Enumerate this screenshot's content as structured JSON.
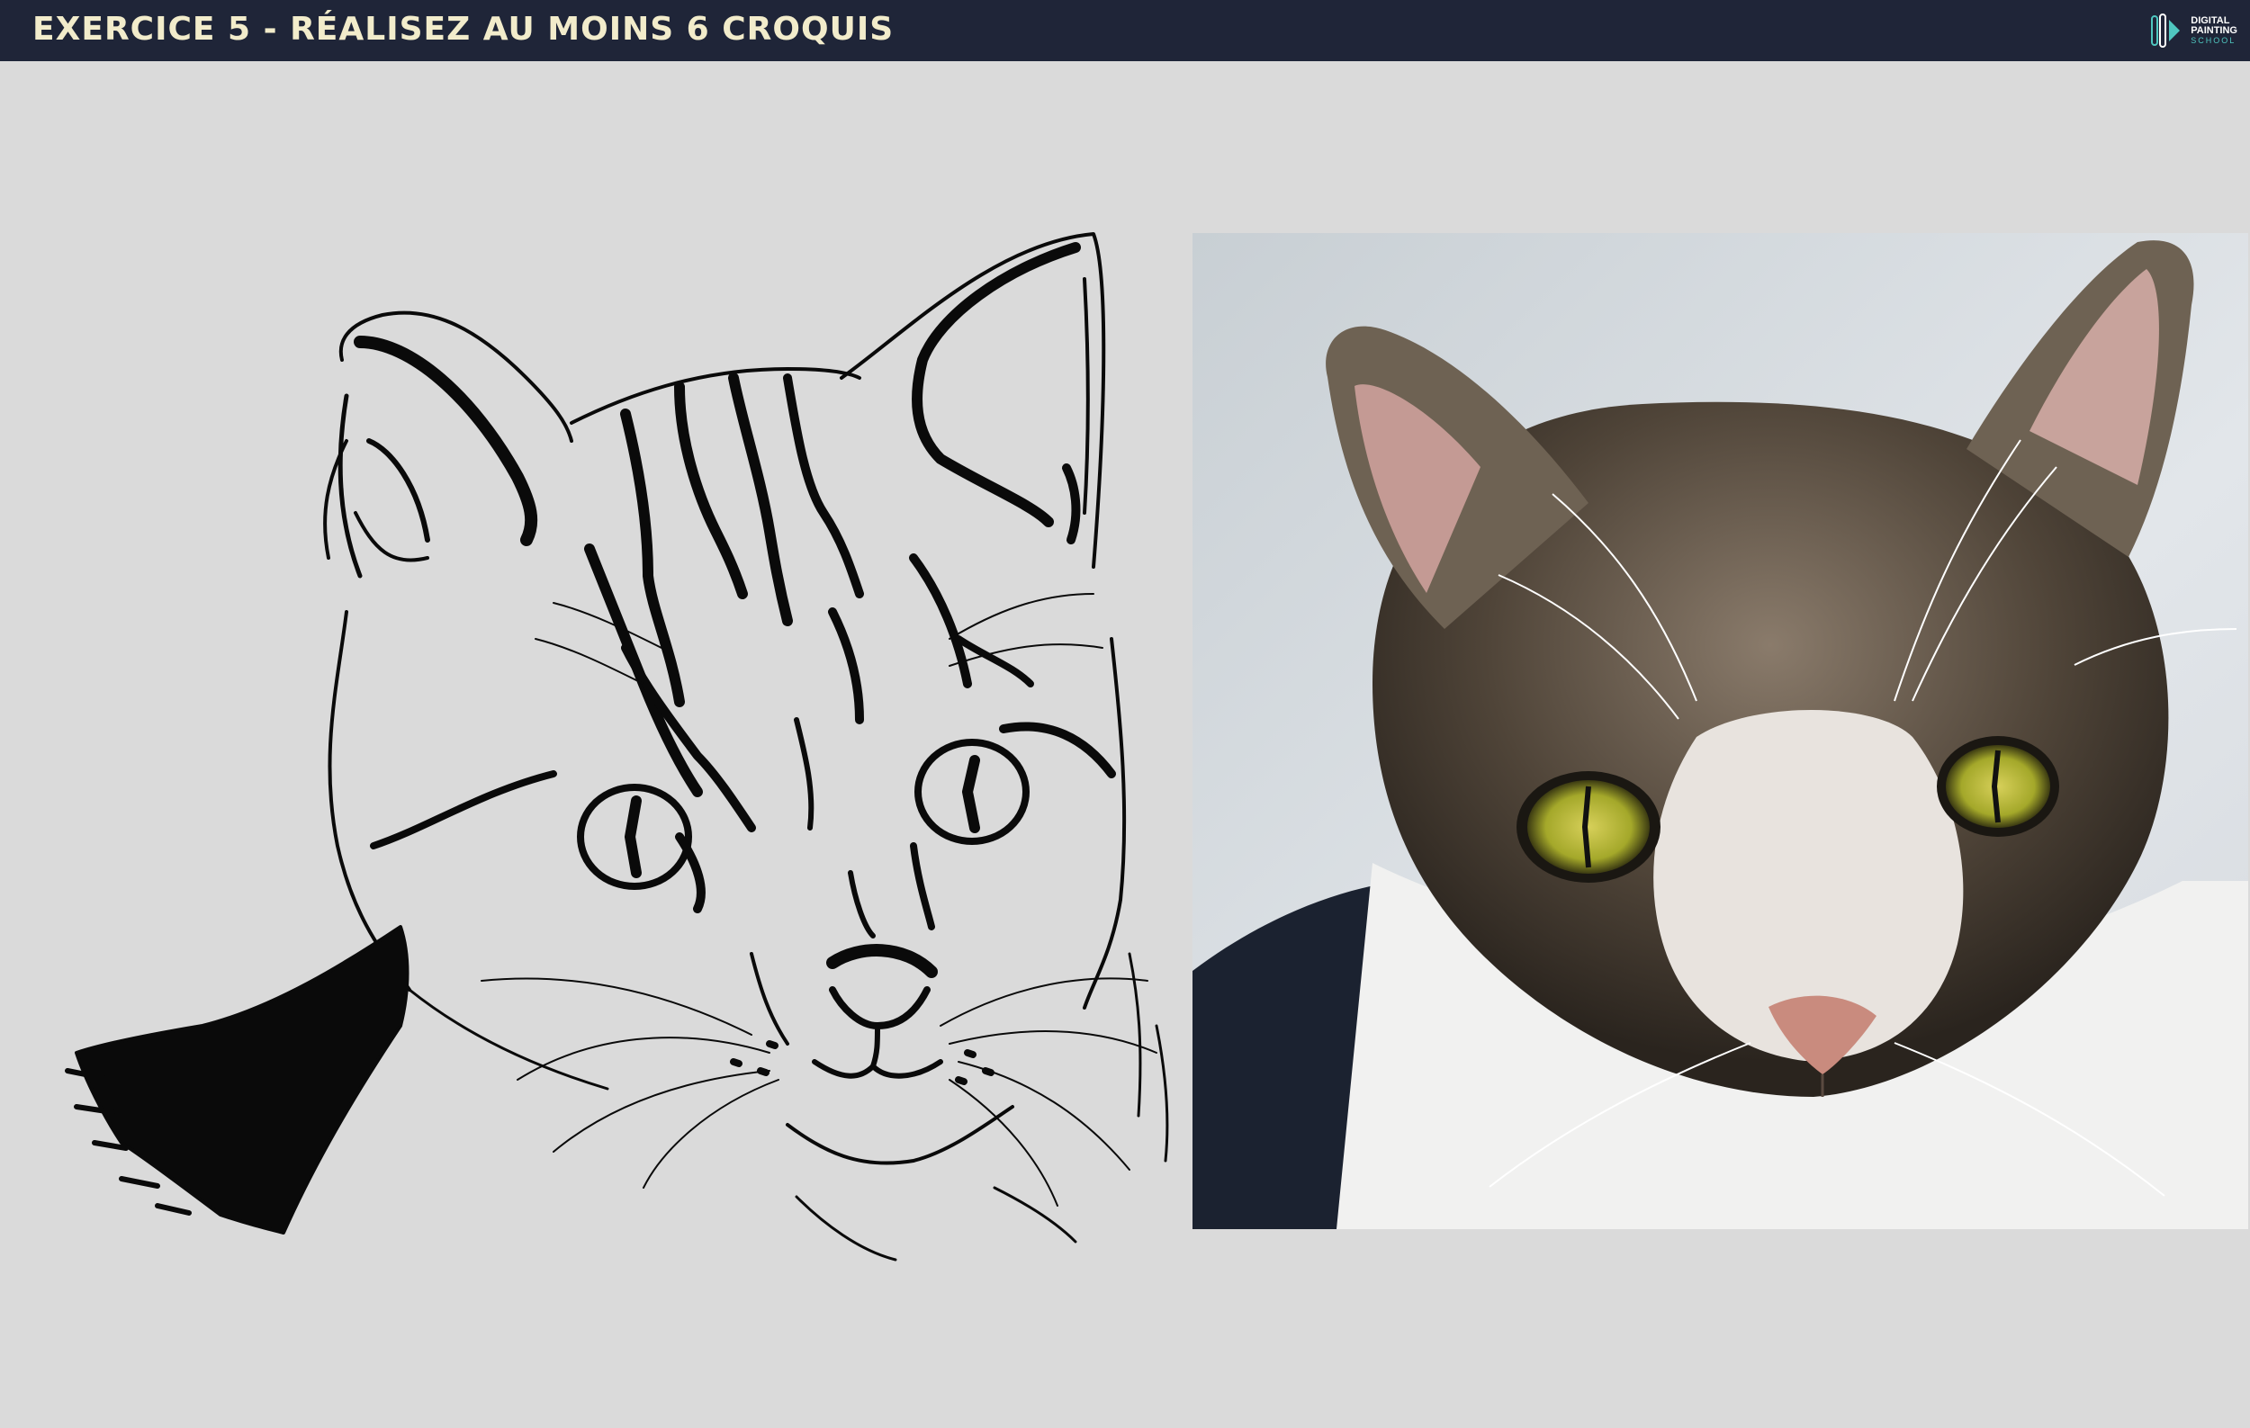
{
  "header": {
    "title": "EXERCICE 5 - RÉALISEZ AU MOINS 6 CROQUIS"
  },
  "logo": {
    "line1": "DIGITAL",
    "line2": "PAINTING",
    "line3": "SCHOOL",
    "icon": "digital-painting-school-logo-icon"
  },
  "colors": {
    "header_bg": "#1f2538",
    "title": "#f2eccb",
    "page_bg": "#dadada",
    "ink": "#0a0a0a",
    "accent": "#4fc7c0"
  }
}
